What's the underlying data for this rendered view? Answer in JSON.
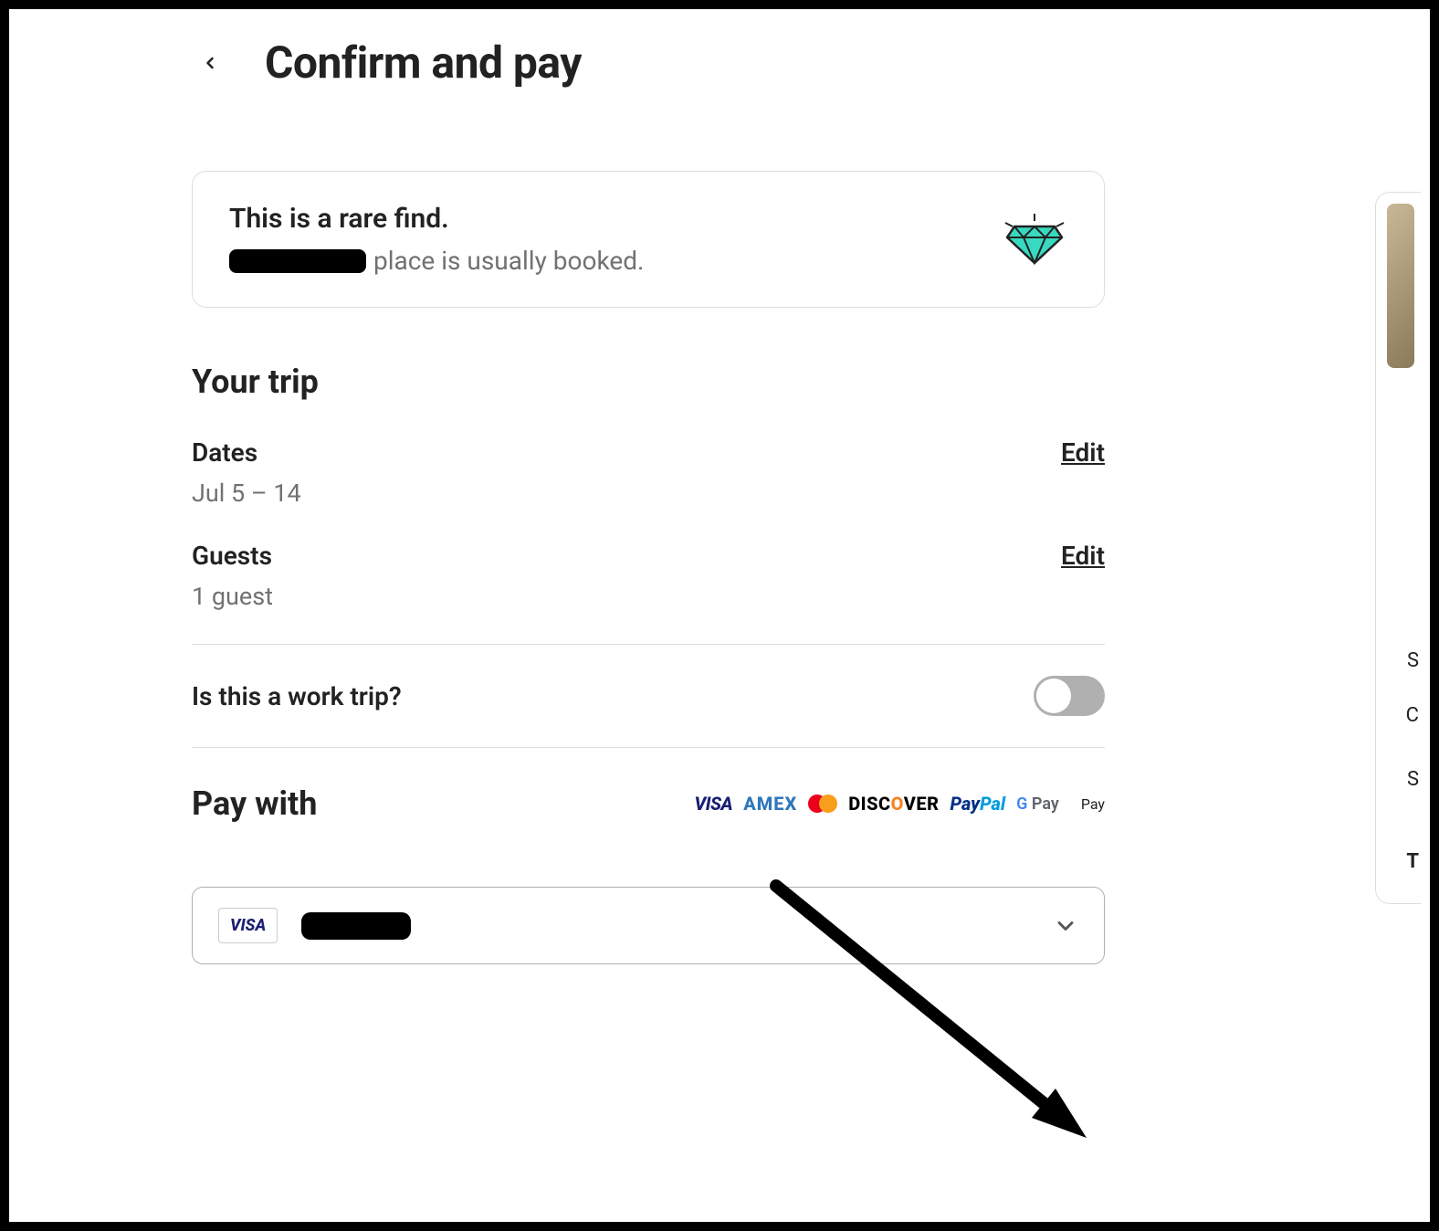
{
  "header": {
    "title": "Confirm and pay"
  },
  "rare_find": {
    "title": "This is a rare find.",
    "subtitle_suffix": "place is usually booked."
  },
  "your_trip": {
    "heading": "Your trip",
    "dates": {
      "label": "Dates",
      "value": "Jul 5 – 14",
      "edit": "Edit"
    },
    "guests": {
      "label": "Guests",
      "value": "1 guest",
      "edit": "Edit"
    }
  },
  "work_trip": {
    "label": "Is this a work trip?",
    "value": false
  },
  "pay_with": {
    "heading": "Pay with",
    "logos": {
      "visa": "VISA",
      "amex": "AMEX",
      "discover_pre": "DISC",
      "discover_post": "VER",
      "paypal_pay": "Pay",
      "paypal_pal": "Pal",
      "gpay_g": "G",
      "gpay_pay": " Pay",
      "apay": " Pay"
    }
  },
  "payment_select": {
    "card_brand": "VISA"
  },
  "sliver": {
    "s1": "S",
    "c": "C",
    "s2": "S",
    "t": "T"
  }
}
